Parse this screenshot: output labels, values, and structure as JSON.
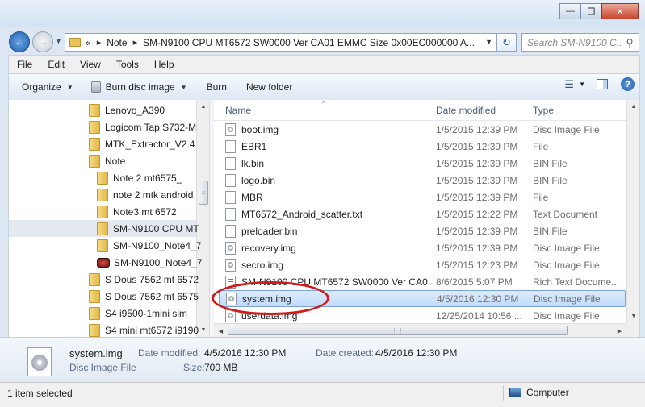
{
  "window": {
    "minimize_icon": "minimize-icon",
    "maximize_icon": "maximize-icon",
    "close_icon": "close-icon"
  },
  "address_bar": {
    "overflow_chevron": "«",
    "crumbs": [
      "Note",
      "SM-N9100 CPU MT6572 SW0000 Ver CA01 EMMC Size 0x00EC000000 A..."
    ],
    "search_placeholder": "Search SM-N9100 C..."
  },
  "menu": [
    "File",
    "Edit",
    "View",
    "Tools",
    "Help"
  ],
  "toolbar": {
    "organize": "Organize",
    "burn_disc_image": "Burn disc image",
    "burn": "Burn",
    "new_folder": "New folder"
  },
  "nav_tree": [
    {
      "label": "Lenovo_A390",
      "icon": "folder-icon",
      "selected": false
    },
    {
      "label": "Logicom Tap S732-M",
      "icon": "folder-icon",
      "selected": false
    },
    {
      "label": "MTK_Extractor_V2.4",
      "icon": "folder-icon",
      "selected": false
    },
    {
      "label": "Note",
      "icon": "folder-icon",
      "selected": false
    },
    {
      "label": "Note 2 mt6575_",
      "icon": "folder-icon",
      "selected": false
    },
    {
      "label": "note 2 mtk android",
      "icon": "folder-icon",
      "selected": false
    },
    {
      "label": "Note3 mt 6572",
      "icon": "folder-icon",
      "selected": false
    },
    {
      "label": "SM-N9100 CPU MT",
      "icon": "folder-icon",
      "selected": true
    },
    {
      "label": "SM-N9100_Note4_7",
      "icon": "folder-icon",
      "selected": false
    },
    {
      "label": "SM-N9100_Note4_7",
      "icon": "device-icon",
      "selected": false
    },
    {
      "label": "S Dous 7562 mt 6572",
      "icon": "folder-icon",
      "selected": false
    },
    {
      "label": "S Dous 7562 mt 6575",
      "icon": "folder-icon",
      "selected": false
    },
    {
      "label": "S4 i9500-1mini sim",
      "icon": "folder-icon",
      "selected": false
    },
    {
      "label": "S4 mini mt6572 i9190",
      "icon": "folder-icon",
      "selected": false
    }
  ],
  "columns": {
    "name": "Name",
    "date": "Date modified",
    "type": "Type"
  },
  "files": [
    {
      "name": "boot.img",
      "date": "1/5/2015 12:39 PM",
      "type": "Disc Image File",
      "icon": "disc-image-icon"
    },
    {
      "name": "EBR1",
      "date": "1/5/2015 12:39 PM",
      "type": "File",
      "icon": "file-icon"
    },
    {
      "name": "lk.bin",
      "date": "1/5/2015 12:39 PM",
      "type": "BIN File",
      "icon": "file-icon"
    },
    {
      "name": "logo.bin",
      "date": "1/5/2015 12:39 PM",
      "type": "BIN File",
      "icon": "file-icon"
    },
    {
      "name": "MBR",
      "date": "1/5/2015 12:39 PM",
      "type": "File",
      "icon": "file-icon"
    },
    {
      "name": "MT6572_Android_scatter.txt",
      "date": "1/5/2015 12:22 PM",
      "type": "Text Document",
      "icon": "file-icon"
    },
    {
      "name": "preloader.bin",
      "date": "1/5/2015 12:39 PM",
      "type": "BIN File",
      "icon": "file-icon"
    },
    {
      "name": "recovery.img",
      "date": "1/5/2015 12:39 PM",
      "type": "Disc Image File",
      "icon": "disc-image-icon"
    },
    {
      "name": "secro.img",
      "date": "1/5/2015 12:23 PM",
      "type": "Disc Image File",
      "icon": "disc-image-icon"
    },
    {
      "name": "SM-N9100 CPU MT6572 SW0000 Ver CA0...",
      "date": "8/6/2015 5:07 PM",
      "type": "Rich Text Docume...",
      "icon": "rtf-icon"
    },
    {
      "name": "system.img",
      "date": "4/5/2016 12:30 PM",
      "type": "Disc Image File",
      "icon": "disc-image-icon",
      "selected": true
    },
    {
      "name": "userdata.img",
      "date": "12/25/2014 10:56 ...",
      "type": "Disc Image File",
      "icon": "disc-image-icon"
    }
  ],
  "details": {
    "filename": "system.img",
    "filetype": "Disc Image File",
    "modified_key": "Date modified:",
    "modified_val": "4/5/2016 12:30 PM",
    "created_key": "Date created:",
    "created_val": "4/5/2016 12:30 PM",
    "size_key": "Size:",
    "size_val": "700 MB"
  },
  "status": {
    "selection": "1 item selected",
    "location": "Computer"
  },
  "colors": {
    "annotation": "#d11a1a",
    "selection": "#c1dcfc",
    "accent": "#1f5fae"
  }
}
